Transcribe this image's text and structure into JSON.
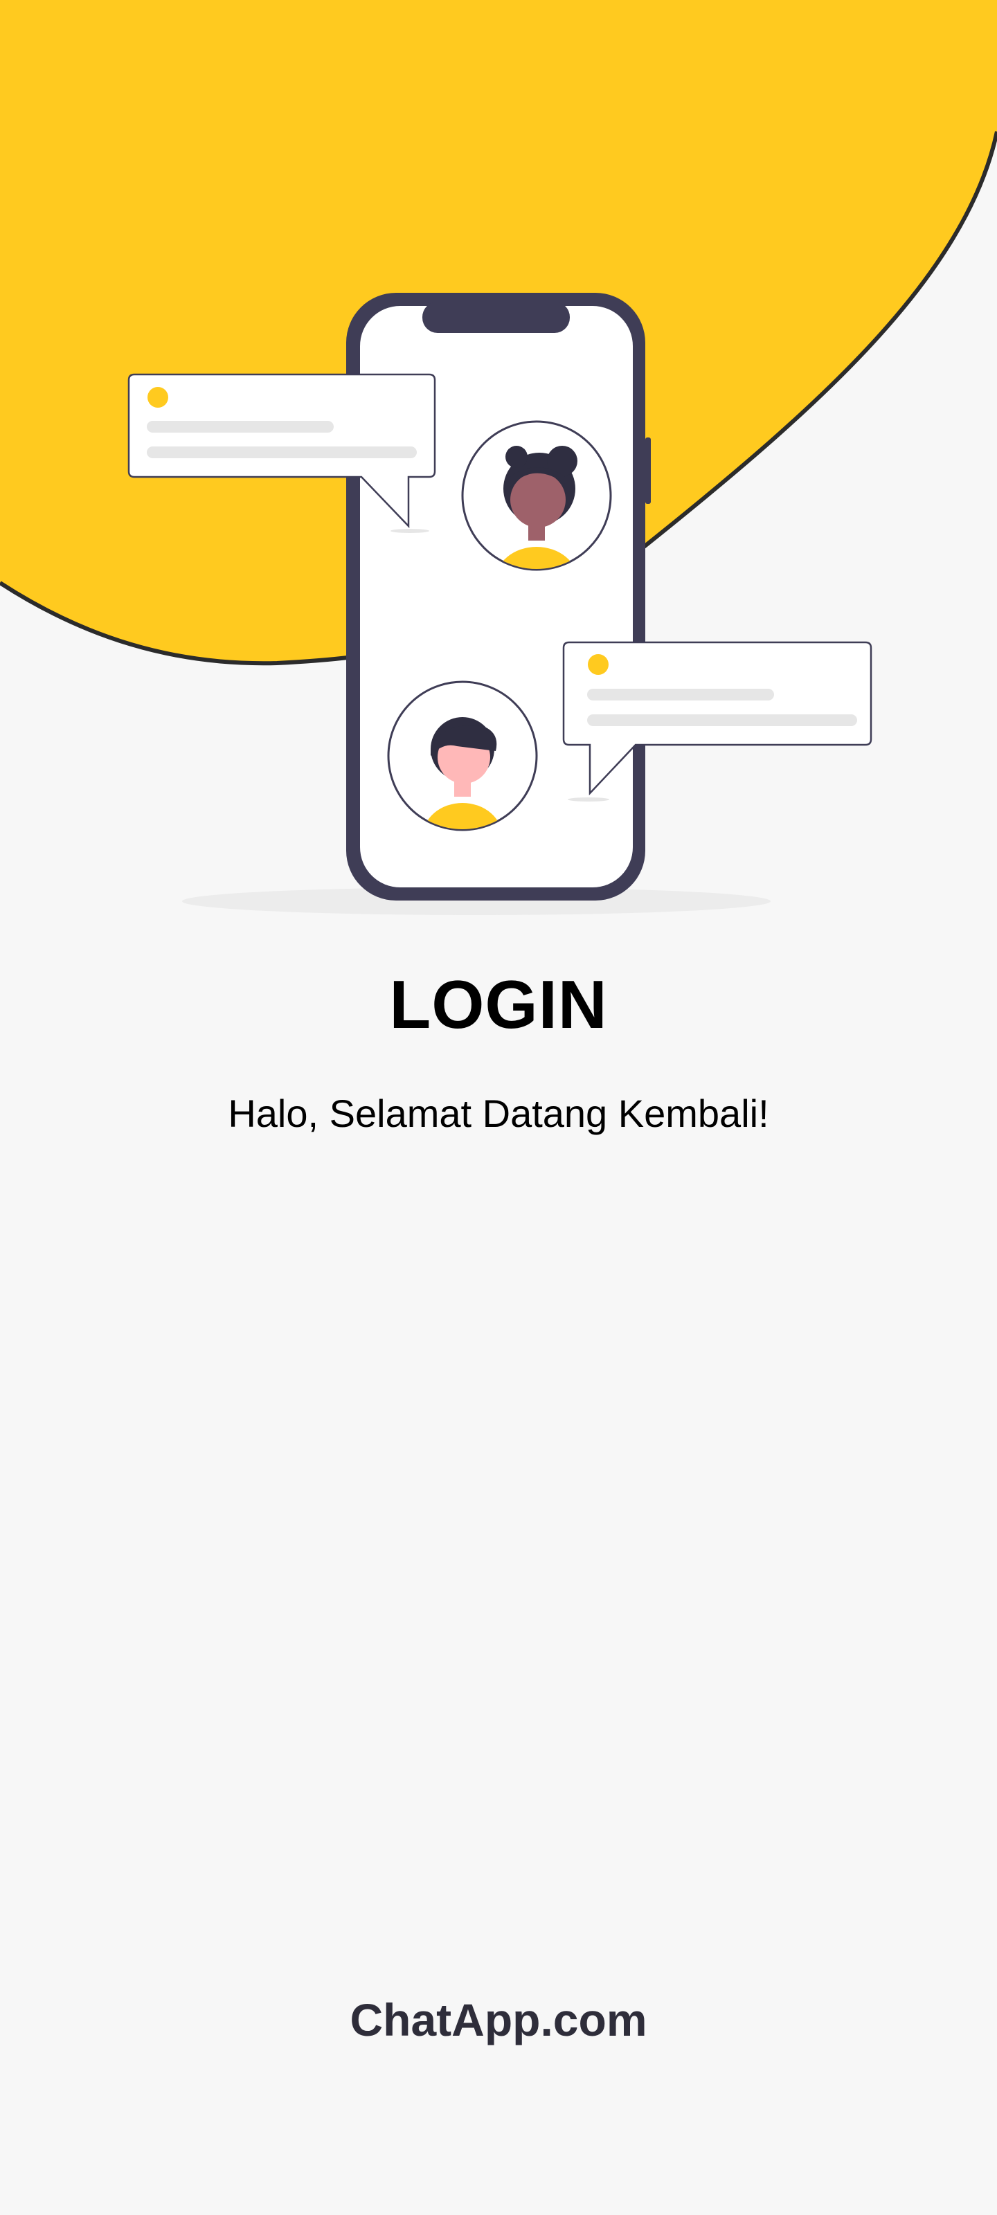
{
  "login": {
    "title": "LOGIN",
    "subtitle": "Halo, Selamat Datang Kembali!"
  },
  "footer": {
    "brand": "ChatApp.com"
  },
  "illustration": {
    "name": "chat-phone-illustration",
    "colors": {
      "accent": "#FFCA1F",
      "background": "#F7F7F7",
      "phone_frame": "#3F3D56",
      "text_dark": "#000000",
      "placeholder_line": "#E6E6E6"
    }
  }
}
